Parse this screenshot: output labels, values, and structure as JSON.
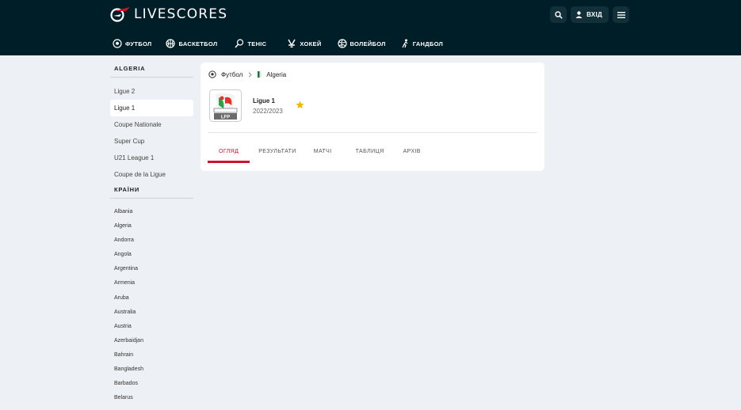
{
  "brand": {
    "name": "LIVESCORES",
    "accent": "#d2112f",
    "header_bg": "#001e28"
  },
  "header": {
    "login_label": "ВХІД",
    "search_icon": "search-icon",
    "menu_icon": "menu-icon",
    "user_icon": "user-icon"
  },
  "sports": [
    {
      "label": "ФУТБОЛ",
      "icon": "football-icon"
    },
    {
      "label": "БАСКЕТБОЛ",
      "icon": "basketball-icon"
    },
    {
      "label": "ТЕНІС",
      "icon": "tennis-icon"
    },
    {
      "label": "ХОКЕЙ",
      "icon": "hockey-icon"
    },
    {
      "label": "ВОЛЕЙБОЛ",
      "icon": "volleyball-icon"
    },
    {
      "label": "ГАНДБОЛ",
      "icon": "handball-icon"
    }
  ],
  "sidebar": {
    "section_title": "ALGERIA",
    "leagues": [
      "Ligue 2",
      "Ligue 1",
      "Coupe Nationale",
      "Super Cup",
      "U21 League 1",
      "Coupe de la Ligue"
    ],
    "active_league": "Ligue 1",
    "countries_title": "КРАЇНИ",
    "countries": [
      "Albania",
      "Algeria",
      "Andorra",
      "Angola",
      "Argentina",
      "Armenia",
      "Aruba",
      "Australia",
      "Austria",
      "Azerbaidjan",
      "Bahrain",
      "Bangladesh",
      "Barbados",
      "Belarus"
    ]
  },
  "main": {
    "breadcrumb": {
      "sport": "Футбол",
      "country": "Algeria"
    },
    "league": {
      "name": "Ligue 1",
      "season": "2022/2023",
      "logo_text": "LFP"
    },
    "tabs": [
      "ОГЛЯД",
      "РЕЗУЛЬТАТИ",
      "МАТЧІ",
      "ТАБЛИЦЯ",
      "АРХІВ"
    ],
    "active_tab": "ОГЛЯД"
  }
}
